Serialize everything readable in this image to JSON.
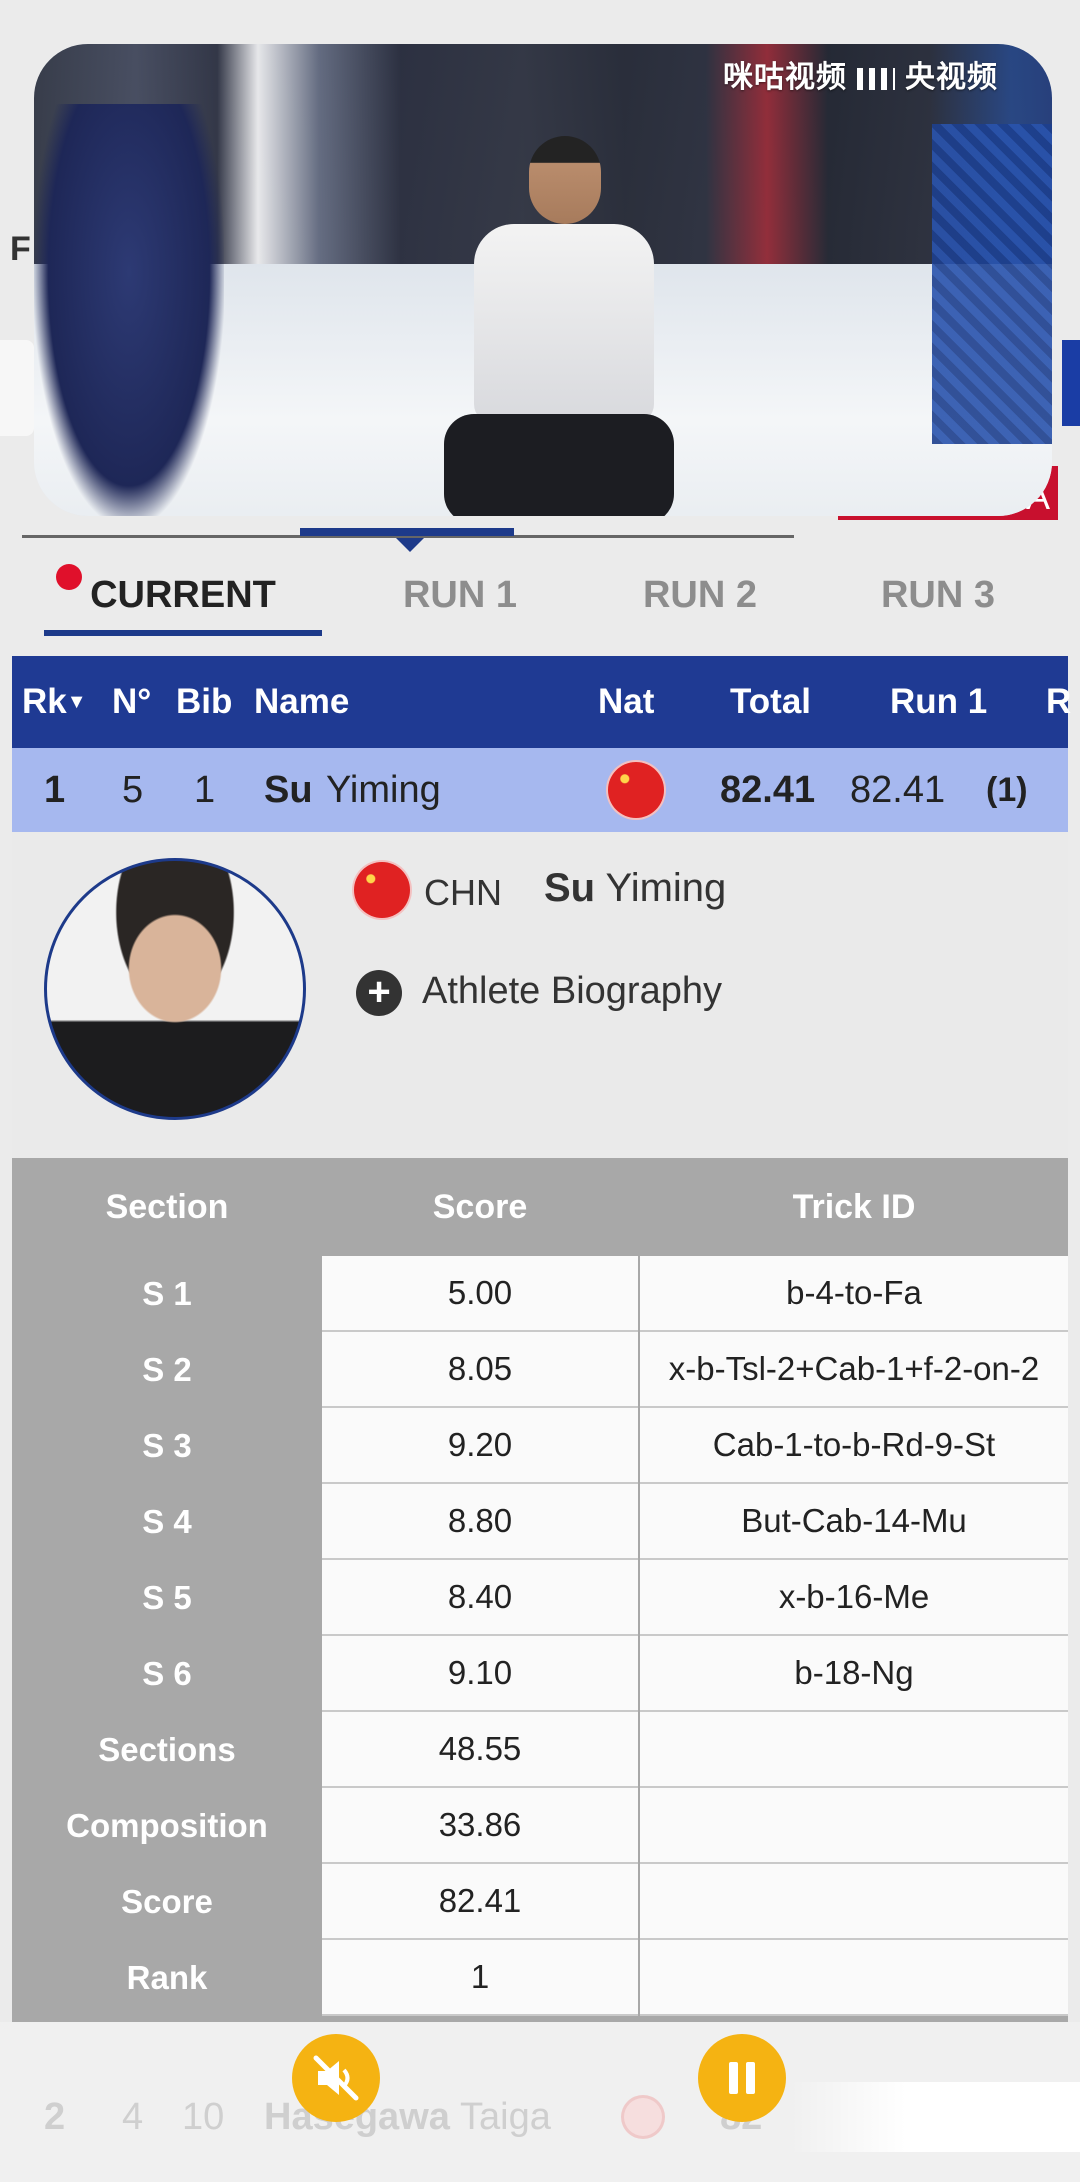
{
  "video": {
    "watermark_left": "咪咕视频",
    "watermark_right": "央视频"
  },
  "background_peek": {
    "letter_f": "F",
    "letter_a": "A"
  },
  "tabs": [
    {
      "label": "CURRENT",
      "active": true
    },
    {
      "label": "RUN 1",
      "active": false
    },
    {
      "label": "RUN 2",
      "active": false
    },
    {
      "label": "RUN 3",
      "active": false
    }
  ],
  "results_header": {
    "rank": "Rk",
    "rank_sort": "▼",
    "number": "N°",
    "bib": "Bib",
    "name": "Name",
    "nat": "Nat",
    "total": "Total",
    "run1": "Run 1",
    "run_next": "R"
  },
  "rows": [
    {
      "rank": "1",
      "number": "5",
      "bib": "1",
      "surname": "Su",
      "given": "Yiming",
      "total": "82.41",
      "run1": "82.41",
      "run1_rank": "(1)"
    },
    {
      "rank": "2",
      "number": "4",
      "bib": "10",
      "surname": "Hasegawa",
      "given": "Taiga",
      "total": "82"
    }
  ],
  "athlete": {
    "nat": "CHN",
    "surname": "Su",
    "given": "Yiming",
    "biography_label": "Athlete Biography"
  },
  "score_table": {
    "headers": {
      "section": "Section",
      "score": "Score",
      "trick": "Trick ID"
    },
    "rows": [
      {
        "section": "S 1",
        "score": "5.00",
        "trick": "b-4-to-Fa"
      },
      {
        "section": "S 2",
        "score": "8.05",
        "trick": "x-b-Tsl-2+Cab-1+f-2-on-2"
      },
      {
        "section": "S 3",
        "score": "9.20",
        "trick": "Cab-1-to-b-Rd-9-St"
      },
      {
        "section": "S 4",
        "score": "8.80",
        "trick": "But-Cab-14-Mu"
      },
      {
        "section": "S 5",
        "score": "8.40",
        "trick": "x-b-16-Me"
      },
      {
        "section": "S 6",
        "score": "9.10",
        "trick": "b-18-Ng"
      },
      {
        "section": "Sections",
        "score": "48.55",
        "trick": ""
      },
      {
        "section": "Composition",
        "score": "33.86",
        "trick": ""
      },
      {
        "section": "Score",
        "score": "82.41",
        "trick": ""
      },
      {
        "section": "Rank",
        "score": "1",
        "trick": ""
      }
    ]
  },
  "controls": {
    "mute_icon": "speaker-muted-icon",
    "pause_icon": "pause-icon"
  },
  "colors": {
    "navy": "#1f3a93",
    "highlight_row": "#a6b8ef",
    "control_yellow": "#f5b312",
    "live_red": "#e0102b"
  }
}
